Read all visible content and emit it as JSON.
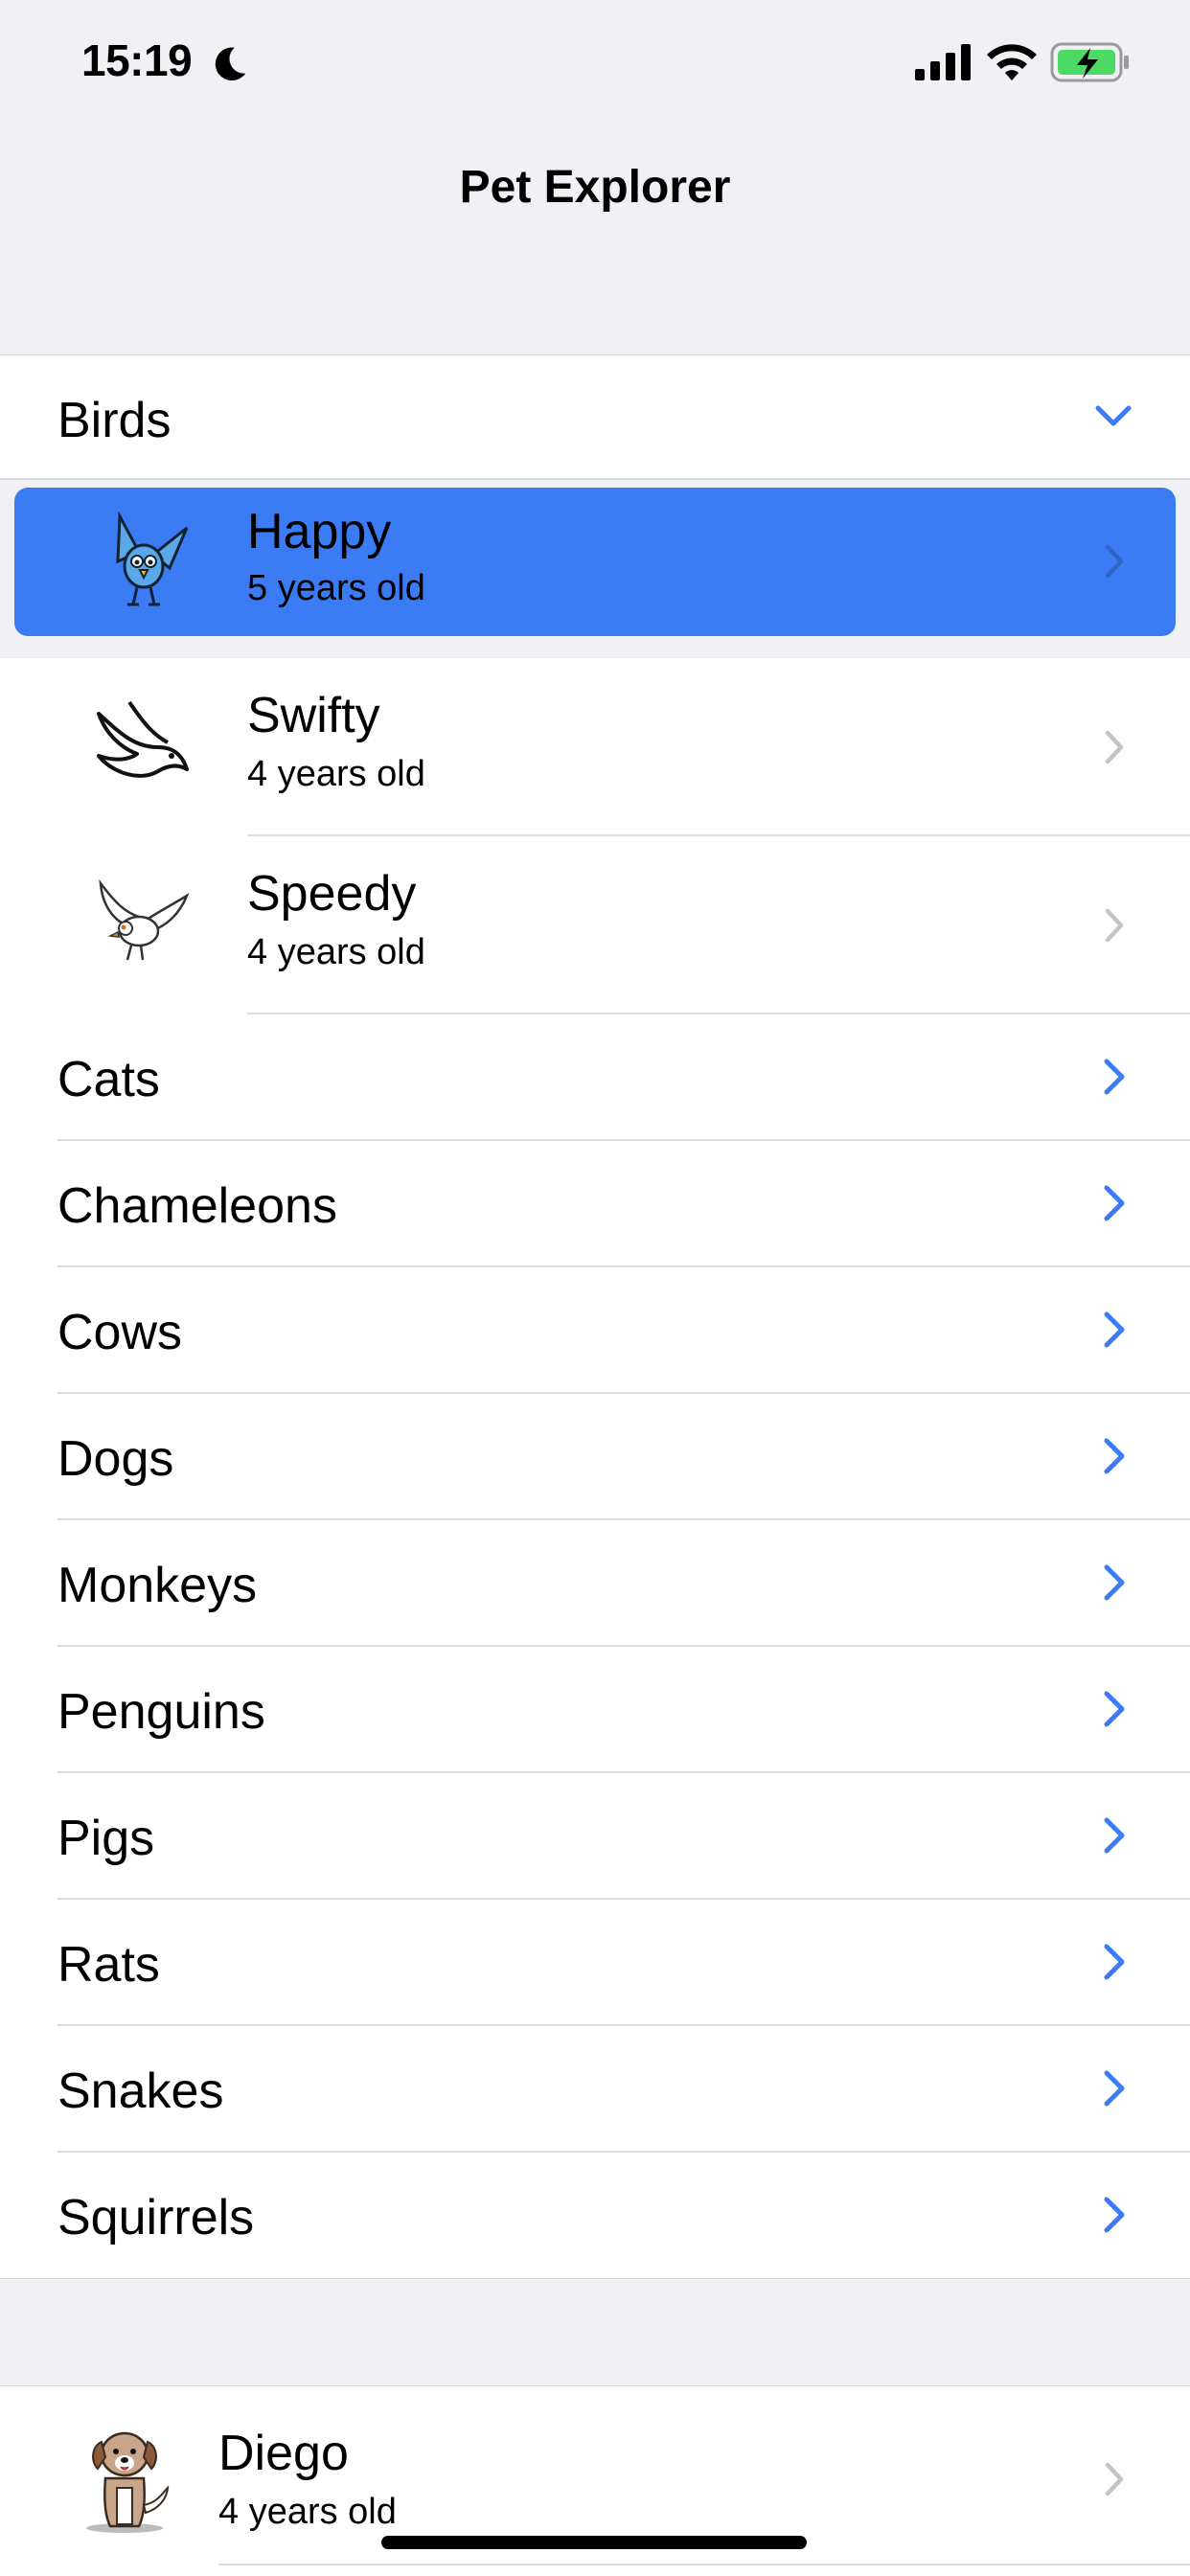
{
  "status_bar": {
    "time": "15:19"
  },
  "nav": {
    "title": "Pet Explorer"
  },
  "expanded_group": {
    "label": "Birds",
    "pets": [
      {
        "name": "Happy",
        "age": "5 years old",
        "selected": true,
        "icon": "blue-bird-icon"
      },
      {
        "name": "Swifty",
        "age": "4 years old",
        "selected": false,
        "icon": "swift-bird-icon"
      },
      {
        "name": "Speedy",
        "age": "4 years old",
        "selected": false,
        "icon": "white-bird-icon"
      }
    ]
  },
  "groups": [
    {
      "label": "Cats"
    },
    {
      "label": "Chameleons"
    },
    {
      "label": "Cows"
    },
    {
      "label": "Dogs"
    },
    {
      "label": "Monkeys"
    },
    {
      "label": "Penguins"
    },
    {
      "label": "Pigs"
    },
    {
      "label": "Rats"
    },
    {
      "label": "Snakes"
    },
    {
      "label": "Squirrels"
    }
  ],
  "bottom_pet": {
    "name": "Diego",
    "age": "4 years old",
    "icon": "dog-icon"
  },
  "colors": {
    "accent": "#3b7cf5",
    "background": "#f0f0f5",
    "separator": "#dcdce0"
  }
}
